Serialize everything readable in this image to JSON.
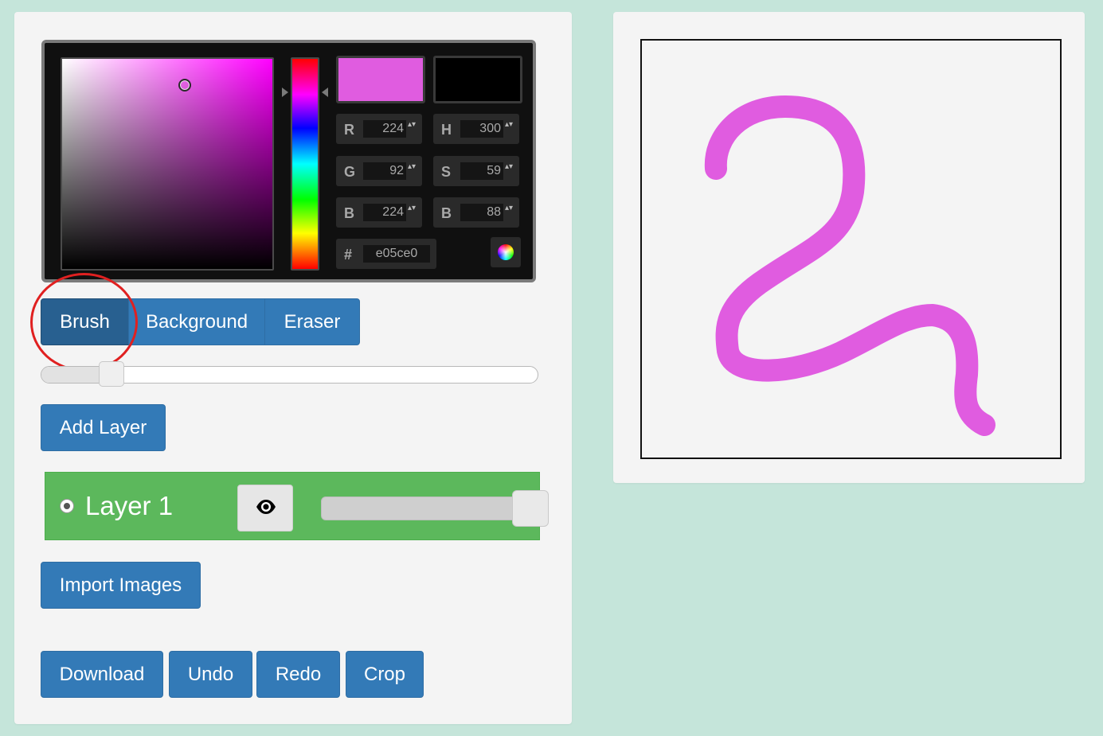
{
  "color_picker": {
    "new_color": "#e05ce0",
    "old_color": "#000000",
    "fields": [
      {
        "id": "r",
        "label": "R",
        "value": "224"
      },
      {
        "id": "g",
        "label": "G",
        "value": "92"
      },
      {
        "id": "b",
        "label": "B",
        "value": "224"
      },
      {
        "id": "h",
        "label": "H",
        "value": "300"
      },
      {
        "id": "s",
        "label": "S",
        "value": "59"
      },
      {
        "id": "v",
        "label": "B",
        "value": "88"
      }
    ],
    "hex_label": "#",
    "hex_value": "e05ce0",
    "spin_glyph": "▴▾"
  },
  "modes": {
    "brush": "Brush",
    "background": "Background",
    "eraser": "Eraser",
    "active": "brush"
  },
  "brush_size": {
    "fraction": 0.14
  },
  "buttons": {
    "add_layer": "Add Layer",
    "import_images": "Import Images",
    "download": "Download",
    "undo": "Undo",
    "redo": "Redo",
    "crop": "Crop"
  },
  "layers": [
    {
      "name": "Layer 1",
      "selected": true,
      "visible": true,
      "opacity_fraction": 1.0,
      "color": "#5cb85c"
    }
  ],
  "canvas": {
    "stroke_color": "#e05ce0",
    "background": "#f4f4f4"
  },
  "colors": {
    "page_bg": "#c5e5da",
    "primary": "#337ab7",
    "primary_active": "#286090",
    "highlight": "#e02020"
  }
}
